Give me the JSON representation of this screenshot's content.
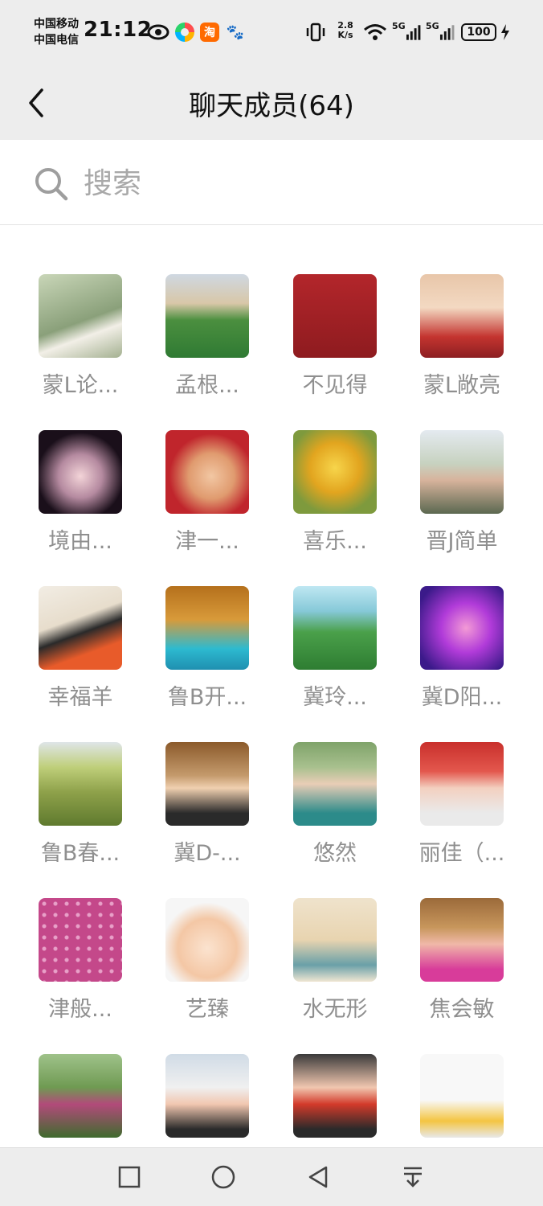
{
  "status_bar": {
    "carrier_1": "中国移动",
    "carrier_2": "中国电信",
    "time": "21:12",
    "net_speed_value": "2.8",
    "net_speed_unit": "K/s",
    "sig1_label": "5G",
    "sig2_label": "5G",
    "battery": "100",
    "app2_glyph": "淘",
    "app3_glyph": "🐾"
  },
  "header": {
    "title": "聊天成员(64)"
  },
  "search": {
    "placeholder": "搜索",
    "value": ""
  },
  "members": [
    {
      "name": "蒙L论...",
      "bg": "linear-gradient(160deg,#c9d6b8,#8aa07a 55%,#f2efe7 70%,#a3b090)"
    },
    {
      "name": "孟根...",
      "bg": "linear-gradient(180deg,#cfd8e2 0%,#d8c7a8 35%,#4b8f3f 55%,#2f7a33)"
    },
    {
      "name": "不见得",
      "bg": "linear-gradient(180deg,#b3262b,#8e1b1f)"
    },
    {
      "name": "蒙L敞亮",
      "bg": "linear-gradient(180deg,#e8c6a9,#f3d9c2 40%,#c4342f 75%,#8c1f22)"
    },
    {
      "name": "境由...",
      "bg": "radial-gradient(circle at 50% 55%,#f3d4d8,#b58aa0 35%,#1a0f1a 70%)"
    },
    {
      "name": "津一...",
      "bg": "radial-gradient(circle at 55% 55%,#f2c7a3,#e09b6f 35%,#c0252c 65%)"
    },
    {
      "name": "喜乐...",
      "bg": "radial-gradient(circle at 50% 45%,#f7d54b,#e2a51f 40%,#7e9a3d 75%)"
    },
    {
      "name": "晋J简单",
      "bg": "linear-gradient(180deg,#e4eaf0,#c7d2c0 40%,#d7b39c 60%,#5b6850)"
    },
    {
      "name": "幸福羊",
      "bg": "linear-gradient(160deg,#f2ede4,#e7ddcc 40%,#2a2a2a 55%,#e85b2a 75%)"
    },
    {
      "name": "鲁B开...",
      "bg": "linear-gradient(180deg,#b5701c,#d89a3a 40%,#2dbad0 75%,#1f8fb0)"
    },
    {
      "name": "冀玲...",
      "bg": "linear-gradient(180deg,#bfe7f2,#86c9d8 30%,#4aa04a 55%,#2e7d32)"
    },
    {
      "name": "冀D阳...",
      "bg": "radial-gradient(circle at 55% 50%,#f39ad6,#b13bd9 40%,#3b1a8a 85%)"
    },
    {
      "name": "鲁B春...",
      "bg": "linear-gradient(180deg,#dfe5e8,#bfcf7a 30%,#8ea14a 60%,#5f7a2e)"
    },
    {
      "name": "冀D-...",
      "bg": "linear-gradient(180deg,#8b5a2b,#c49a6c 40%,#f0d0b0 55%,#2a2a2a 85%)"
    },
    {
      "name": "悠然",
      "bg": "linear-gradient(180deg,#7fa36a,#a8c08e 30%,#e9cdb6 50%,#2c8b8a 85%)"
    },
    {
      "name": "丽佳（...",
      "bg": "linear-gradient(180deg,#c9302c,#e3574d 35%,#f3d0c0 55%,#eaeaea 85%)"
    },
    {
      "name": "津般...",
      "bg": "radial-gradient(circle,#e8a0c8 2px,#c4488a 3px) 0 0/14px 14px,#c4488a"
    },
    {
      "name": "艺臻",
      "bg": "radial-gradient(circle at 50% 60%,#fbe3cf,#f4c7a5 45%,#f6f6f6 70%)"
    },
    {
      "name": "水无形",
      "bg": "linear-gradient(180deg,#efe3cc,#e8d4b0 50%,#6aa0a8 80%,#f0e6d2)"
    },
    {
      "name": "焦会敏",
      "bg": "linear-gradient(180deg,#9b6a3a,#c7965c 35%,#f0b8a8 55%,#d83c9a 85%)"
    },
    {
      "name": "",
      "bg": "linear-gradient(180deg,#9fc28a,#6f9a52 40%,#b24a7a 60%,#3f6b2e)"
    },
    {
      "name": "",
      "bg": "linear-gradient(180deg,#d0dbe6,#f0f0f0 40%,#f1c7b0 60%,#2a2a2a 90%)"
    },
    {
      "name": "",
      "bg": "linear-gradient(180deg,#3a3a3a,#f1c7b0 40%,#d33a2a 60%,#2a2a2a 90%)"
    },
    {
      "name": "",
      "bg": "linear-gradient(180deg,#f8f8f8,#f8f8f8 55%,#f4c542 80%,#e8e8e8)"
    }
  ]
}
